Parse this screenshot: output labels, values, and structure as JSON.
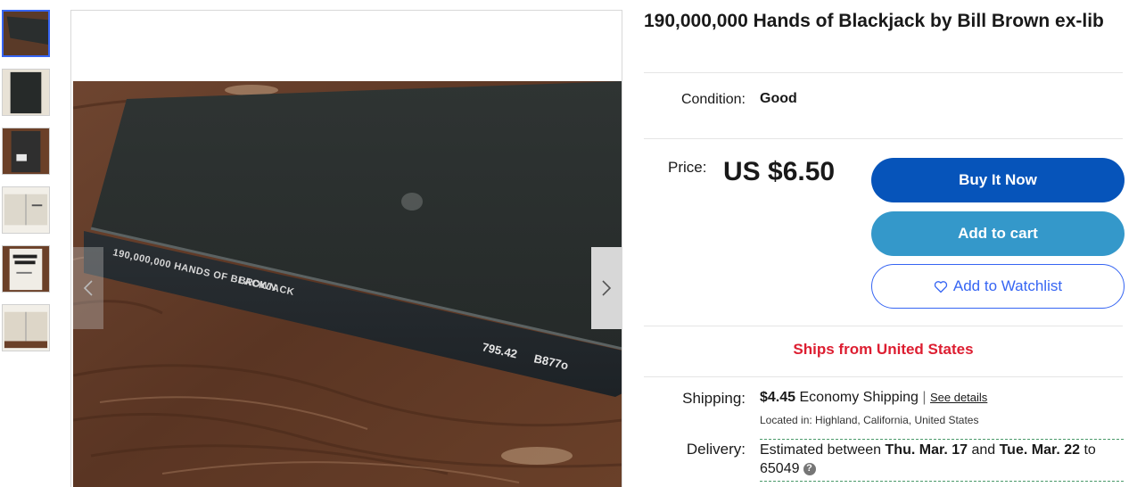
{
  "listing": {
    "title": "190,000,000 Hands of Blackjack by Bill Brown ex-lib",
    "condition_label": "Condition:",
    "condition_value": "Good",
    "price_label": "Price:",
    "price": "US $6.50"
  },
  "buttons": {
    "buy_now": "Buy It Now",
    "add_to_cart": "Add to cart",
    "add_to_watchlist": "Add to Watchlist"
  },
  "ships_from": "Ships from United States",
  "shipping": {
    "label": "Shipping:",
    "cost": "$4.45",
    "method": "Economy Shipping",
    "separator": "|",
    "see_details": "See details",
    "located_in": "Located in:  Highland, California, United States"
  },
  "delivery": {
    "label": "Delivery:",
    "prefix": "Estimated between ",
    "start": "Thu. Mar. 17",
    "middle": " and ",
    "end": "Tue. Mar. 22",
    "suffix": " to 65049"
  },
  "photo": {
    "spine_title": "190,000,000 HANDS OF BLACKJACK",
    "spine_author": "BROWN",
    "call_number_1": "795.42",
    "call_number_2": "B877o"
  },
  "colors": {
    "buy_now": "#0654ba",
    "add_to_cart": "#3498ca",
    "accent": "#3665f3",
    "ships_from": "#dd1e31"
  },
  "icons": {
    "prev": "chevron-left-icon",
    "next": "chevron-right-icon",
    "watch": "heart-icon",
    "help": "question-icon"
  }
}
